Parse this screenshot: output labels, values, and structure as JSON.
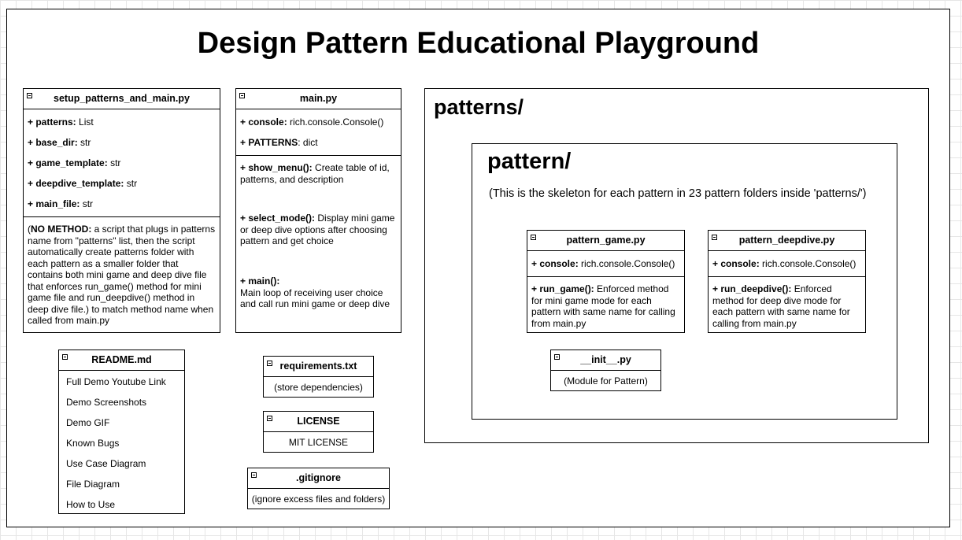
{
  "title": "Design Pattern Educational Playground",
  "setup": {
    "name": "setup_patterns_and_main.py",
    "attrs": [
      {
        "label": "+ patterns:",
        "type": "List"
      },
      {
        "label": "+ base_dir:",
        "type": "str"
      },
      {
        "label": "+ game_template:",
        "type": "str"
      },
      {
        "label": "+ deepdive_template:",
        "type": "str"
      },
      {
        "label": "+ main_file:",
        "type": "str"
      }
    ],
    "note_bold": "NO METHOD:",
    "note_open": "(",
    "note_text": " a script that plugs in patterns name from \"patterns\" list, then the script automatically create patterns folder with each pattern as a smaller folder that contains both mini game and deep dive file that enforces run_game() method for mini game file and run_deepdive() method in deep dive file.) to match method name when called from main.py"
  },
  "main": {
    "name": "main.py",
    "attrs": [
      {
        "label": "+ console:",
        "type": "rich.console.Console()"
      },
      {
        "label": "+ PATTERNS",
        "type": ": dict"
      }
    ],
    "methods": [
      {
        "label": "+ show_menu():",
        "desc": " Create table of id, patterns, and description"
      },
      {
        "label": "+ select_mode():",
        "desc": " Display mini game or deep dive options after choosing pattern and get choice"
      },
      {
        "label": "+ main():",
        "desc": "Main loop of receiving user choice and call run mini game or deep dive"
      }
    ]
  },
  "readme": {
    "name": "README.md",
    "items": [
      "Full Demo Youtube Link",
      "Demo Screenshots",
      "Demo GIF",
      "Known Bugs",
      "Use Case Diagram",
      "File Diagram",
      "How to Use"
    ]
  },
  "requirements": {
    "name": "requirements.txt",
    "desc": "(store dependencies)"
  },
  "license": {
    "name": "LICENSE",
    "desc": "MIT LICENSE"
  },
  "gitignore": {
    "name": ".gitignore",
    "desc": "(ignore excess files and folders)"
  },
  "patterns_folder": {
    "title": "patterns/",
    "pattern_folder": {
      "title": "pattern/",
      "note": "(This is the skeleton for each pattern in 23 pattern folders inside 'patterns/')",
      "game": {
        "name": "pattern_game.py",
        "attr_label": "+ console:",
        "attr_type": "rich.console.Console()",
        "method_label": "+ run_game():",
        "method_desc": " Enforced method for mini game mode for each pattern with same name for calling from main.py"
      },
      "deepdive": {
        "name": "pattern_deepdive.py",
        "attr_label": "+ console:",
        "attr_type": "rich.console.Console()",
        "method_label": "+ run_deepdive():",
        "method_desc": " Enforced method for deep dive mode for each pattern with same name for calling from main.py"
      },
      "init": {
        "name": "__init__.py",
        "desc": "(Module for Pattern)"
      }
    }
  }
}
